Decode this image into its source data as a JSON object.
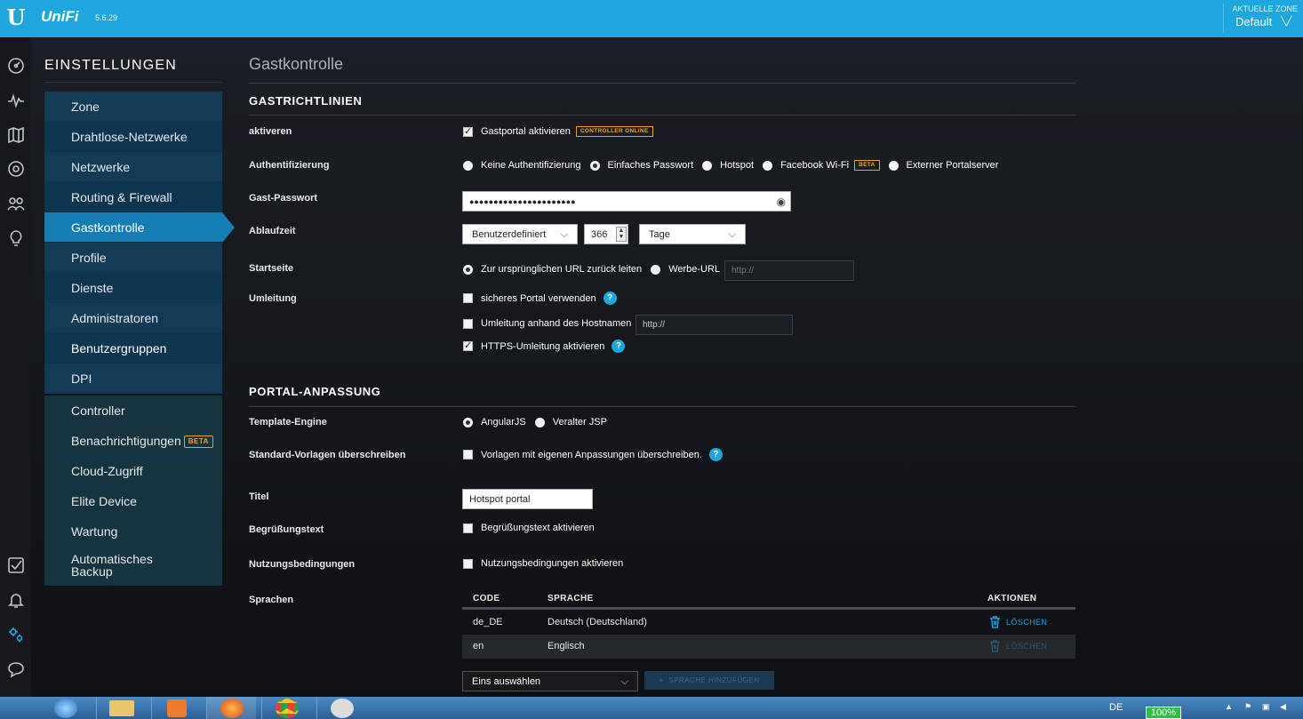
{
  "header": {
    "logo": "U",
    "brand": "UniFi",
    "version": "5.6.29",
    "zone_label": "AKTUELLE ZONE",
    "zone_value": "Default"
  },
  "rail": {
    "icons": [
      "dashboard-icon",
      "statistics-icon",
      "map-icon",
      "devices-icon",
      "clients-icon",
      "insights-icon",
      "alerts-check-icon",
      "notifications-bell-icon",
      "settings-gear-icon",
      "chat-icon"
    ],
    "active": "settings-gear-icon"
  },
  "sidebar": {
    "title": "EINSTELLUNGEN",
    "items": [
      "Zone",
      "Drahtlose-Netzwerke",
      "Netzwerke",
      "Routing & Firewall",
      "Gastkontrolle",
      "Profile",
      "Dienste",
      "Administratoren",
      "Benutzergruppen",
      "DPI"
    ],
    "selected": "Gastkontrolle",
    "items2": [
      "Controller",
      "Benachrichtigungen",
      "Cloud-Zugriff",
      "Elite Device",
      "Wartung",
      "Automatisches",
      "Backup"
    ],
    "beta_badge": "BETA"
  },
  "page": {
    "title": "Gastkontrolle"
  },
  "guest_policies": {
    "title": "GASTRICHTLINIEN",
    "enable_label": "aktiveren",
    "enable_option": "Gastportal aktivieren",
    "controller_online": "CONTROLLER ONLINE",
    "auth_label": "Authentifizierung",
    "auth_options": [
      "Keine Authentifizierung",
      "Einfaches Passwort",
      "Hotspot",
      "Facebook Wi-Fi",
      "Externer Portalserver"
    ],
    "auth_selected": "Einfaches Passwort",
    "facebook_beta": "BETA",
    "password_label": "Gast-Passwort",
    "password_value": "●●●●●●●●●●●●●●●●●●●●●●",
    "expiry_label": "Ablaufzeit",
    "expiry_mode": "Benutzerdefiniert",
    "expiry_value": "366",
    "expiry_unit": "Tage",
    "landing_label": "Startseite",
    "landing_options": [
      "Zur ursprünglichen URL zurück leiten",
      "Werbe-URL"
    ],
    "landing_url_placeholder": "http://",
    "redirect_label": "Umleitung",
    "secure_portal": "sicheres Portal verwenden",
    "hostname_redirect": "Umleitung anhand des Hostnamen",
    "hostname_placeholder": "http://",
    "https_redirect": "HTTPS-Umleitung aktivieren",
    "help": "?"
  },
  "portal": {
    "title": "PORTAL-ANPASSUNG",
    "engine_label": "Template-Engine",
    "engine_options": [
      "AngularJS",
      "Veralter JSP"
    ],
    "override_label": "Standard-Vorlagen überschreiben",
    "override_option": "Vorlagen mit eigenen Anpassungen überschreiben.",
    "title_label": "Titel",
    "title_value": "Hotspot portal",
    "welcome_label": "Begrüßungstext",
    "welcome_option": "Begrüßungstext aktivieren",
    "terms_label": "Nutzungsbedingungen",
    "terms_option": "Nutzungsbedingungen aktivieren",
    "languages_label": "Sprachen",
    "table_headers": [
      "CODE",
      "SPRACHE",
      "AKTIONEN"
    ],
    "rows": [
      {
        "code": "de_DE",
        "language": "Deutsch (Deutschland)",
        "action": "LÖSCHEN"
      },
      {
        "code": "en",
        "language": "Englisch",
        "action": "LÖSCHEN"
      }
    ],
    "select_placeholder": "Eins auswählen",
    "add_language": "SPRACHE HINZUFÜGEN"
  },
  "taskbar": {
    "locale": "DE",
    "battery": "100%"
  }
}
